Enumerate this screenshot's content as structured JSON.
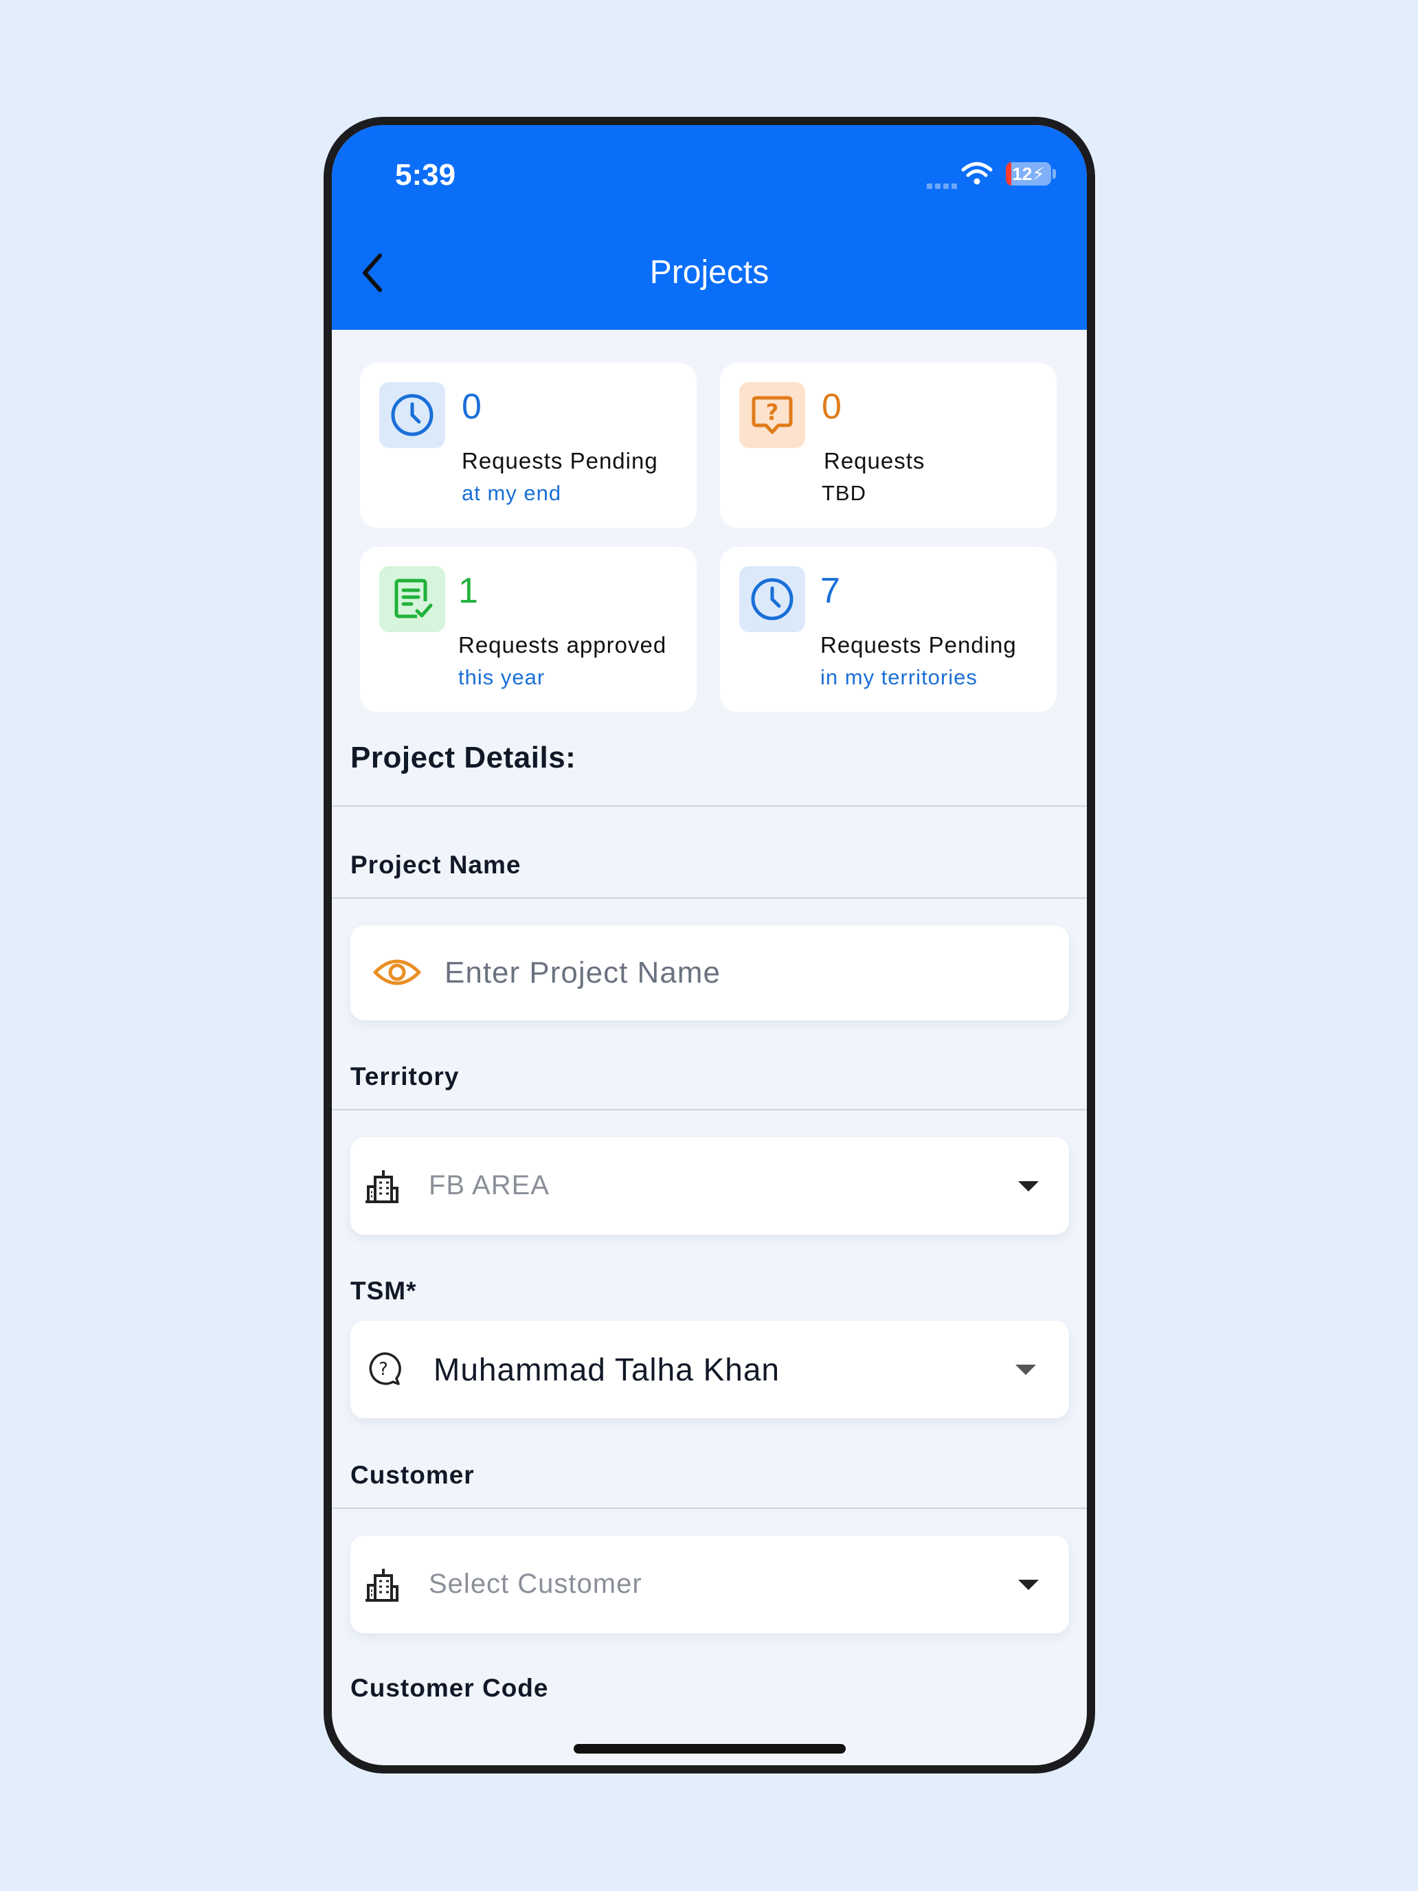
{
  "status": {
    "time": "5:39",
    "battery": "12"
  },
  "header": {
    "title": "Projects"
  },
  "stats": [
    {
      "value": "0",
      "label": "Requests Pending",
      "sub": "at my end"
    },
    {
      "value": "0",
      "label": "Requests",
      "sub": "TBD"
    },
    {
      "value": "1",
      "label": "Requests approved",
      "sub": "this year"
    },
    {
      "value": "7",
      "label": "Requests Pending",
      "sub": "in my territories"
    }
  ],
  "form": {
    "section_title": "Project Details:",
    "project_name": {
      "label": "Project Name",
      "placeholder": "Enter Project Name"
    },
    "territory": {
      "label": "Territory",
      "value": "FB AREA"
    },
    "tsm": {
      "label": "TSM*",
      "value": "Muhammad Talha Khan"
    },
    "customer": {
      "label": "Customer",
      "placeholder": "Select Customer"
    },
    "customer_code": {
      "label": "Customer Code"
    }
  },
  "colors": {
    "primary": "#0b6ef9",
    "blue": "#1a6fd8",
    "orange": "#e07b1a",
    "green": "#21b13a"
  }
}
